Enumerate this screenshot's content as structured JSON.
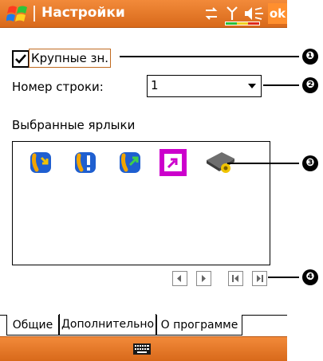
{
  "titlebar": {
    "title": "Настройки",
    "ok_label": "ok"
  },
  "settings": {
    "large_icons_label": "Крупные зн.",
    "large_icons_checked": true,
    "row_number_label": "Номер строки:",
    "row_number_value": "1",
    "favorites_label": "Выбранные ярлыки"
  },
  "callouts": [
    "❶",
    "❷",
    "❸",
    "❹"
  ],
  "tabs": [
    {
      "label": "Общие"
    },
    {
      "label": "Дополнительно",
      "active": true
    },
    {
      "label": "О программе"
    }
  ],
  "colors": {
    "accent": "#e57a2a",
    "highlight": "#cc00cc"
  }
}
